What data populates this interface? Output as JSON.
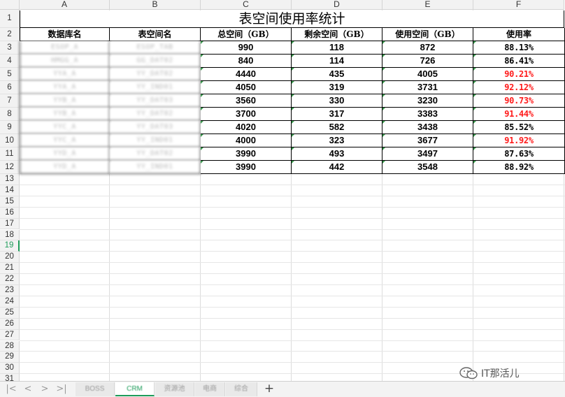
{
  "spreadsheet": {
    "column_headers": [
      "A",
      "B",
      "C",
      "D",
      "E",
      "F"
    ],
    "row_headers": [
      "1",
      "2",
      "3",
      "4",
      "5",
      "6",
      "7",
      "8",
      "9",
      "10",
      "11",
      "12",
      "13",
      "14",
      "15",
      "16",
      "17",
      "18",
      "19",
      "20",
      "21",
      "22",
      "23",
      "24",
      "25",
      "26",
      "27",
      "28",
      "29",
      "30",
      "31"
    ],
    "active_row": "19",
    "title": "表空间使用率统计",
    "table_headers": [
      "数据库名",
      "表空间名",
      "总空间（GB）",
      "剩余空间（GB）",
      "使用空间（GB）",
      "使用率"
    ],
    "rows": [
      {
        "db": "ESOP_A",
        "tablespace": "ESOP_TAB",
        "total": "990",
        "free": "118",
        "used": "872",
        "rate": "88.13%",
        "high": false
      },
      {
        "db": "HMGG_A",
        "tablespace": "GG_DAT02",
        "total": "840",
        "free": "114",
        "used": "726",
        "rate": "86.41%",
        "high": false
      },
      {
        "db": "YYA_A",
        "tablespace": "YY_DAT02",
        "total": "4440",
        "free": "435",
        "used": "4005",
        "rate": "90.21%",
        "high": true
      },
      {
        "db": "YYA_A",
        "tablespace": "YY_IND01",
        "total": "4050",
        "free": "319",
        "used": "3731",
        "rate": "92.12%",
        "high": true
      },
      {
        "db": "YYB_A",
        "tablespace": "YY_DAT03",
        "total": "3560",
        "free": "330",
        "used": "3230",
        "rate": "90.73%",
        "high": true
      },
      {
        "db": "YYB_A",
        "tablespace": "YY_DAT02",
        "total": "3700",
        "free": "317",
        "used": "3383",
        "rate": "91.44%",
        "high": true
      },
      {
        "db": "YYC_A",
        "tablespace": "YY_DAT03",
        "total": "4020",
        "free": "582",
        "used": "3438",
        "rate": "85.52%",
        "high": false
      },
      {
        "db": "YYC_A",
        "tablespace": "YY_IND01",
        "total": "4000",
        "free": "323",
        "used": "3677",
        "rate": "91.92%",
        "high": true
      },
      {
        "db": "YYD_A",
        "tablespace": "YY_DAT02",
        "total": "3990",
        "free": "493",
        "used": "3497",
        "rate": "87.63%",
        "high": false
      },
      {
        "db": "YYD_A",
        "tablespace": "YY_IND01",
        "total": "3990",
        "free": "442",
        "used": "3548",
        "rate": "88.92%",
        "high": false
      }
    ]
  },
  "sheet_tabs": {
    "nav": {
      "first": "|<",
      "prev": "<",
      "next": ">",
      "last": ">|"
    },
    "tabs": [
      {
        "label": "BOSS",
        "active": false
      },
      {
        "label": "CRM",
        "active": true
      },
      {
        "label": "资源池",
        "active": false
      },
      {
        "label": "电商",
        "active": false
      },
      {
        "label": "综合",
        "active": false
      }
    ],
    "add_label": "+"
  },
  "watermark": {
    "text": "IT那活儿",
    "icon": "wechat-icon"
  },
  "colors": {
    "high_rate": "#ff1a1a",
    "accent": "#1e9c5a",
    "grid": "#dcdcdc"
  }
}
